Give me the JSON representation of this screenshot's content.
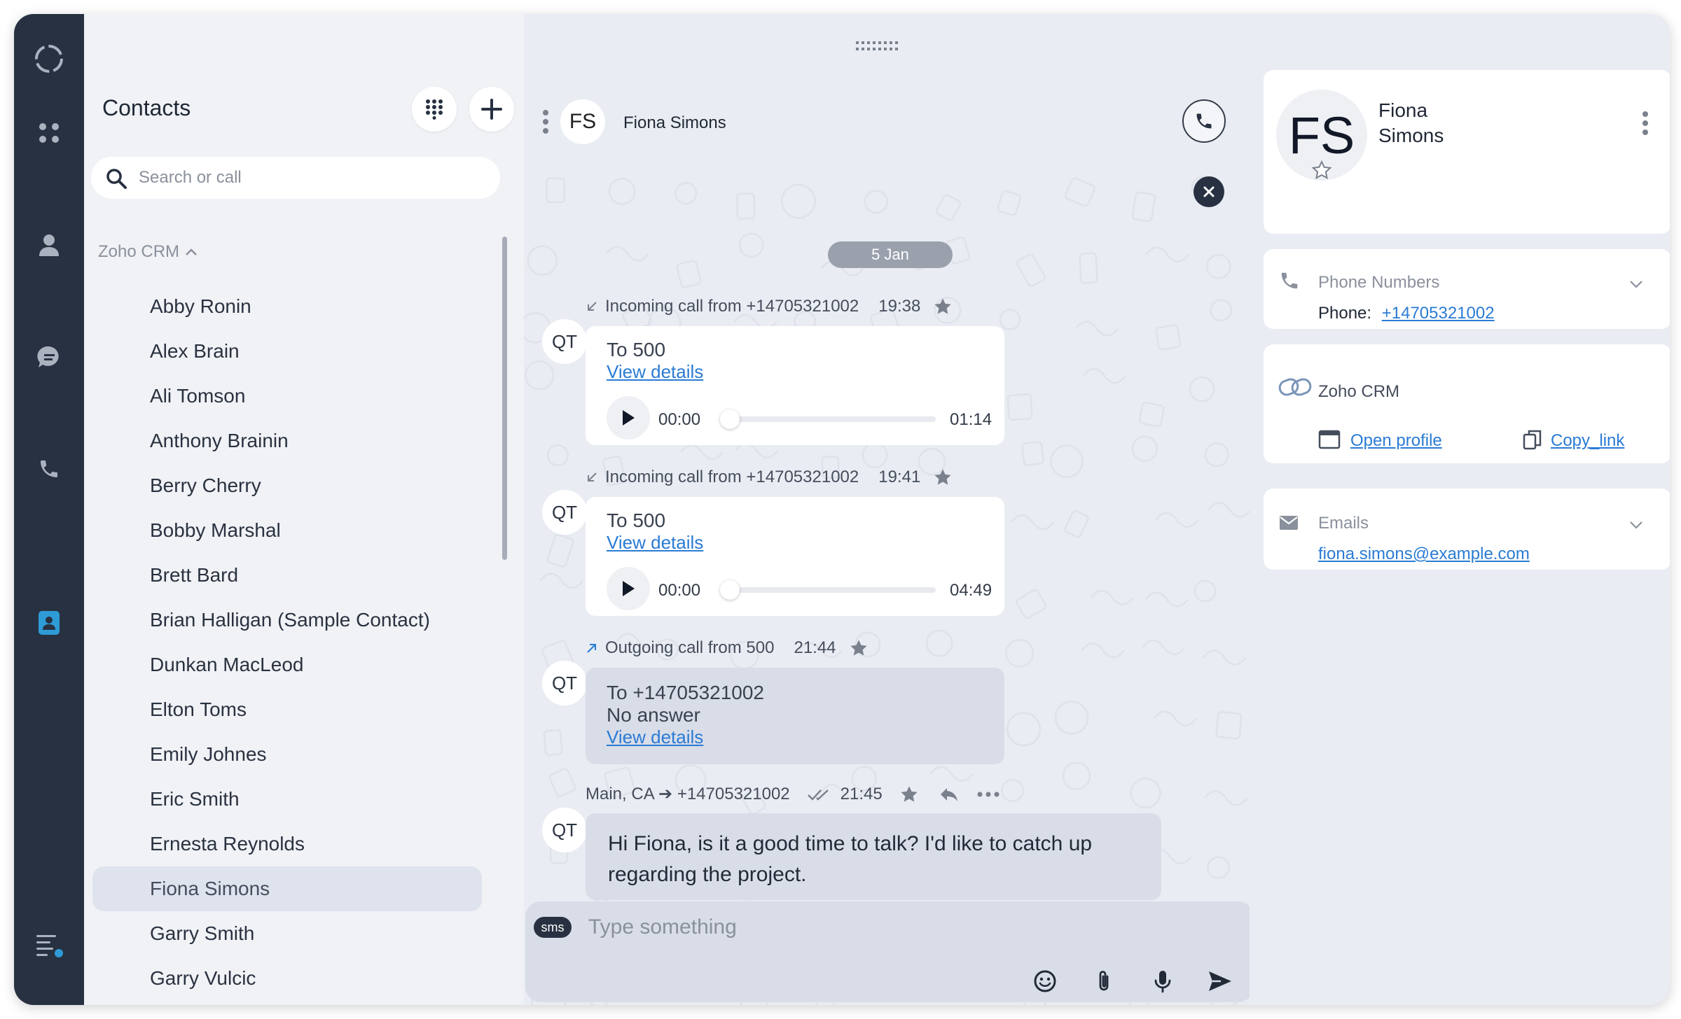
{
  "window": {
    "traffic_lights": {
      "close": "#ec5f57",
      "minimize": "#f3bd4e",
      "maximize": "#5fc454"
    }
  },
  "rail": {
    "background": "#283141",
    "icons": [
      "app-logo-icon",
      "dashboard-grid-icon",
      "person-icon",
      "chat-bubble-icon",
      "phone-icon",
      "contacts-book-icon",
      "menu-notification-icon"
    ],
    "active": "contacts-book-icon",
    "accent": "#2e9bd6"
  },
  "contacts": {
    "title": "Contacts",
    "search_placeholder": "Search or call",
    "group_label": "Zoho CRM",
    "items": [
      "Abby Ronin",
      "Alex Brain",
      "Ali Tomson",
      "Anthony Brainin",
      "Berry Cherry",
      "Bobby Marshal",
      "Brett Bard",
      "Brian Halligan (Sample Contact)",
      "Dunkan MacLeod",
      "Elton Toms",
      "Emily Johnes",
      "Eric Smith",
      "Ernesta Reynolds",
      "Fiona Simons",
      "Garry Smith",
      "Garry Vulcic"
    ],
    "selected": "Fiona Simons"
  },
  "chat": {
    "avatar": "FS",
    "name": "Fiona Simons",
    "date": "5 Jan",
    "sender_avatar": "QT",
    "calls": [
      {
        "header": "Incoming call from +14705321002",
        "time": "19:38",
        "to": "To 500",
        "link": "View details",
        "start": "00:00",
        "duration": "01:14"
      },
      {
        "header": "Incoming call from +14705321002",
        "time": "19:41",
        "to": "To 500",
        "link": "View details",
        "start": "00:00",
        "duration": "04:49"
      },
      {
        "header": "Outgoing call from 500",
        "time": "21:44",
        "to": "To +14705321002",
        "status": "No answer",
        "link": "View details"
      }
    ],
    "sms": {
      "route": "Main, CA ➔ +14705321002",
      "time": "21:45",
      "text": "Hi Fiona, is it a good time to talk? I'd like to catch up regarding the project."
    },
    "composer": {
      "badge": "sms",
      "placeholder": "Type something"
    }
  },
  "details": {
    "avatar": "FS",
    "first_name": "Fiona",
    "last_name": "Simons",
    "phone_section": "Phone Numbers",
    "phone_label": "Phone:",
    "phone_value": "+14705321002",
    "crm_label": "Zoho CRM",
    "open_profile": "Open profile",
    "copy_link": "Copy_link",
    "emails_section": "Emails",
    "email": "fiona.simons@example.com"
  }
}
